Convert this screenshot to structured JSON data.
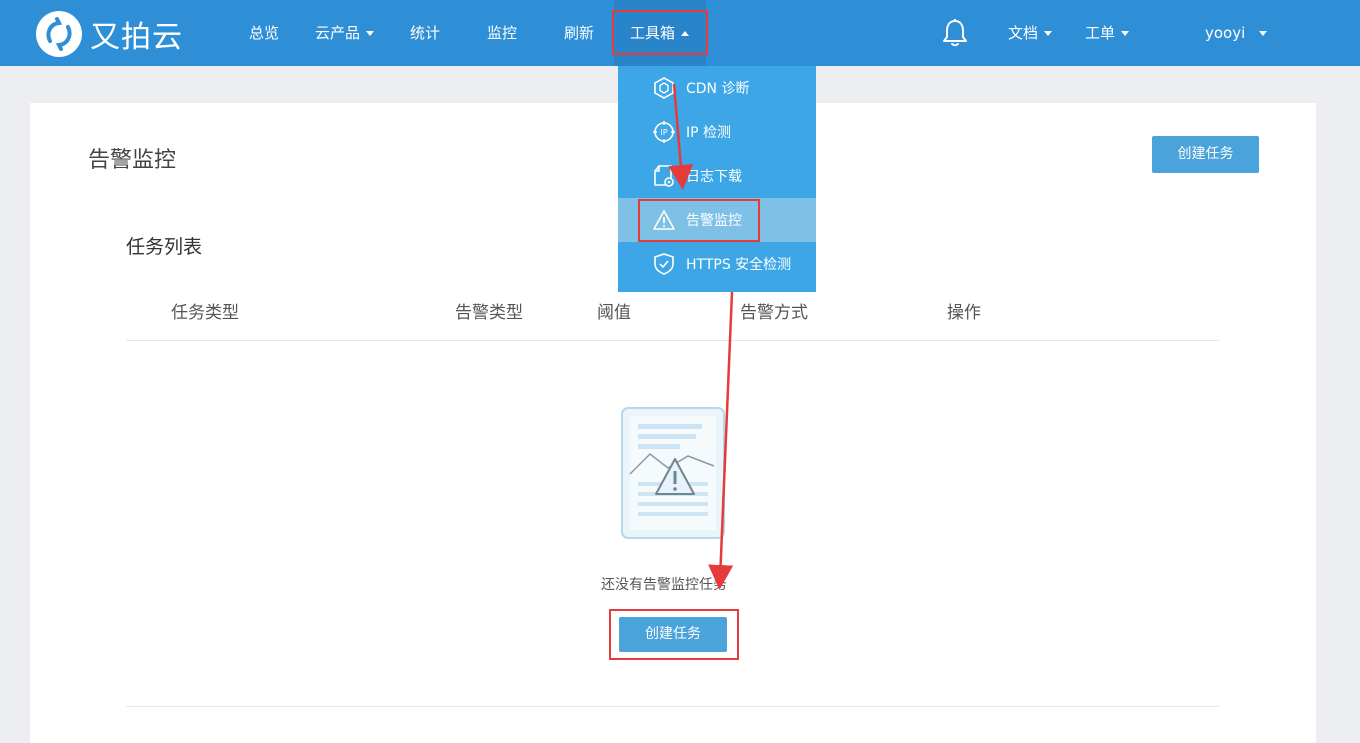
{
  "app": {
    "brand": "又拍云"
  },
  "nav": {
    "overview": "总览",
    "products": "云产品",
    "stats": "统计",
    "monitor": "监控",
    "refresh": "刷新",
    "toolbox": "工具箱",
    "docs": "文档",
    "tickets": "工单",
    "user": "yooyi"
  },
  "toolbox_menu": {
    "items": [
      {
        "label": "CDN 诊断",
        "icon": "hexagon-icon"
      },
      {
        "label": "IP 检测",
        "icon": "ip-target-icon"
      },
      {
        "label": "日志下载",
        "icon": "log-gear-icon"
      },
      {
        "label": "告警监控",
        "icon": "warning-triangle-icon"
      },
      {
        "label": "HTTPS 安全检测",
        "icon": "shield-check-icon"
      }
    ],
    "active_index": 3
  },
  "page": {
    "title": "告警监控",
    "create_button": "创建任务",
    "section_title": "任务列表",
    "columns": [
      "任务类型",
      "告警类型",
      "阈值",
      "告警方式",
      "操作"
    ],
    "empty_text": "还没有告警监控任务",
    "empty_create_button": "创建任务"
  },
  "colors": {
    "nav_bg": "#2f8fd6",
    "dropdown_bg": "#3da6e6",
    "dropdown_active": "#7ec0e6",
    "button": "#4aa3db",
    "annotation_red": "#e53b3b"
  }
}
